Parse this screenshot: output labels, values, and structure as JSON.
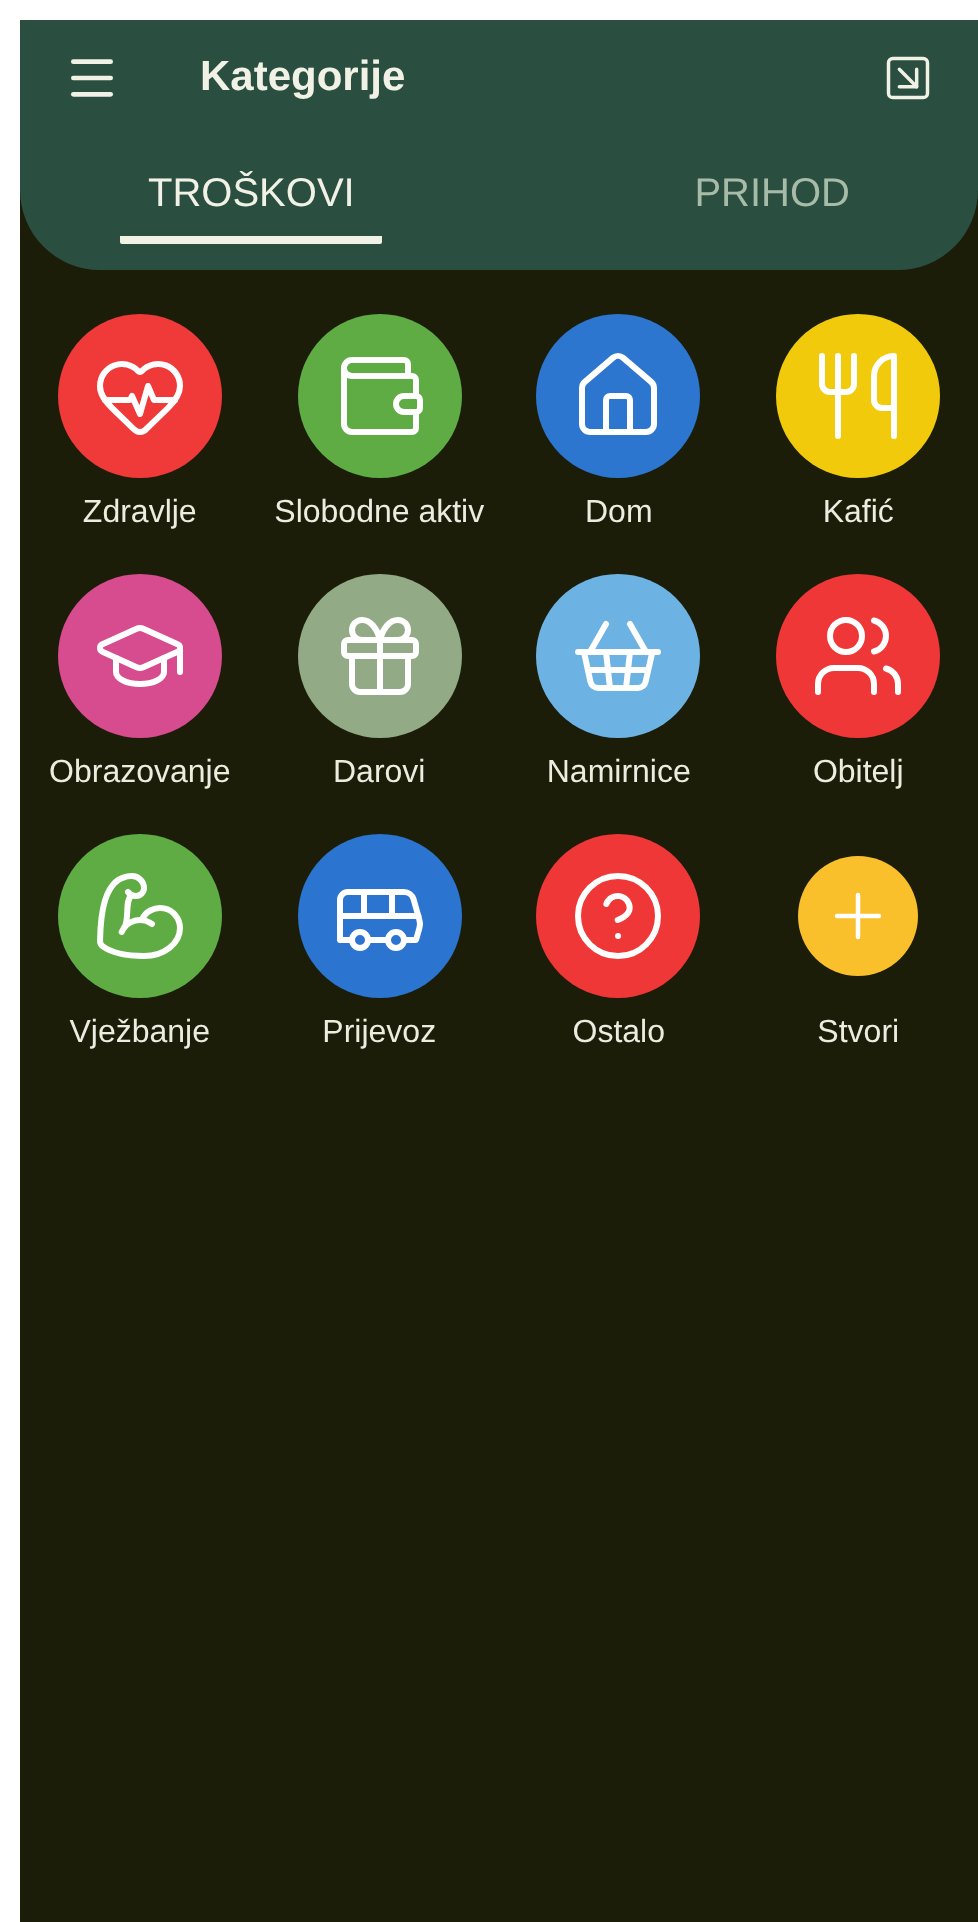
{
  "app_bar": {
    "title": "Kategorije"
  },
  "tabs": [
    {
      "label": "TROŠKOVI",
      "selected": true
    },
    {
      "label": "PRIHOD",
      "selected": false
    }
  ],
  "categories": [
    {
      "label": "Zdravlje",
      "color": "#f03a3a",
      "kind": "category"
    },
    {
      "label": "Slobodne aktiv",
      "color": "#5fac45",
      "kind": "category"
    },
    {
      "label": "Dom",
      "color": "#2d76d0",
      "kind": "category"
    },
    {
      "label": "Kafić",
      "color": "#f1cb0b",
      "kind": "category"
    },
    {
      "label": "Obrazovanje",
      "color": "#d74b8f",
      "kind": "category"
    },
    {
      "label": "Darovi",
      "color": "#92ab86",
      "kind": "category"
    },
    {
      "label": "Namirnice",
      "color": "#6cb3e3",
      "kind": "category"
    },
    {
      "label": "Obitelj",
      "color": "#ef3737",
      "kind": "category"
    },
    {
      "label": "Vježbanje",
      "color": "#5fac45",
      "kind": "category"
    },
    {
      "label": "Prijevoz",
      "color": "#2b74cf",
      "kind": "category"
    },
    {
      "label": "Ostalo",
      "color": "#ef3737",
      "kind": "category"
    },
    {
      "label": "Stvori",
      "color": "#f9c02c",
      "kind": "create"
    }
  ]
}
